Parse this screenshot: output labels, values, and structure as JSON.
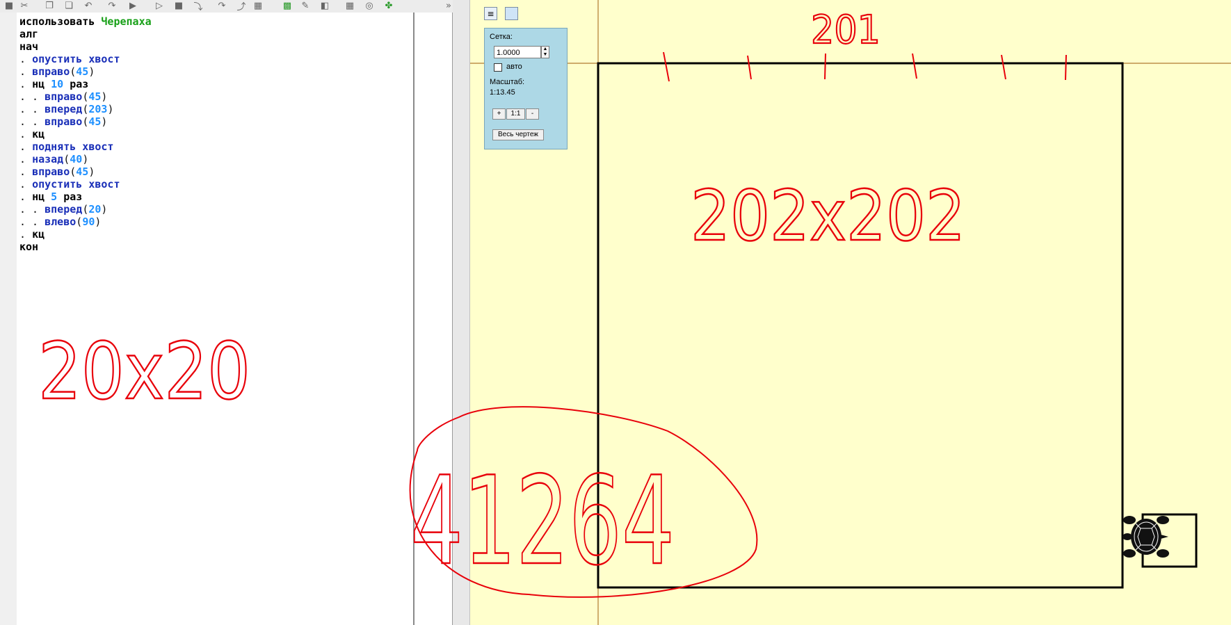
{
  "toolbar": {
    "icons": [
      "save-icon",
      "cut-icon",
      "copy-icon",
      "paste-icon",
      "undo-icon",
      "redo-icon",
      "run-icon",
      "step-icon",
      "stop-icon",
      "step-into-icon",
      "step-over-icon",
      "step-out-icon",
      "robot-icon",
      "grid-icon",
      "pen-icon",
      "turtle-window-icon",
      "table-icon",
      "gamepad-icon",
      "turtle-icon"
    ],
    "more": "»"
  },
  "code": {
    "lines": [
      [
        {
          "t": "использовать ",
          "c": "kw"
        },
        {
          "t": "Черепаха",
          "c": "mod"
        }
      ],
      [
        {
          "t": "алг",
          "c": "kw"
        }
      ],
      [
        {
          "t": "нач",
          "c": "kw"
        }
      ],
      [
        {
          "t": ". ",
          "c": "pun"
        },
        {
          "t": "опустить хвост",
          "c": "cmd"
        }
      ],
      [
        {
          "t": ". ",
          "c": "pun"
        },
        {
          "t": "вправо",
          "c": "cmd"
        },
        {
          "t": "(",
          "c": "pun"
        },
        {
          "t": "45",
          "c": "num"
        },
        {
          "t": ")",
          "c": "pun"
        }
      ],
      [
        {
          "t": ". ",
          "c": "pun"
        },
        {
          "t": "нц ",
          "c": "kw"
        },
        {
          "t": "10",
          "c": "num"
        },
        {
          "t": " раз",
          "c": "kw"
        }
      ],
      [
        {
          "t": ". . ",
          "c": "pun"
        },
        {
          "t": "вправо",
          "c": "cmd"
        },
        {
          "t": "(",
          "c": "pun"
        },
        {
          "t": "45",
          "c": "num"
        },
        {
          "t": ")",
          "c": "pun"
        }
      ],
      [
        {
          "t": ". . ",
          "c": "pun"
        },
        {
          "t": "вперед",
          "c": "cmd"
        },
        {
          "t": "(",
          "c": "pun"
        },
        {
          "t": "203",
          "c": "num"
        },
        {
          "t": ")",
          "c": "pun"
        }
      ],
      [
        {
          "t": ". . ",
          "c": "pun"
        },
        {
          "t": "вправо",
          "c": "cmd"
        },
        {
          "t": "(",
          "c": "pun"
        },
        {
          "t": "45",
          "c": "num"
        },
        {
          "t": ")",
          "c": "pun"
        }
      ],
      [
        {
          "t": ". ",
          "c": "pun"
        },
        {
          "t": "кц",
          "c": "kw"
        }
      ],
      [
        {
          "t": ". ",
          "c": "pun"
        },
        {
          "t": "поднять хвост",
          "c": "cmd"
        }
      ],
      [
        {
          "t": ". ",
          "c": "pun"
        },
        {
          "t": "назад",
          "c": "cmd"
        },
        {
          "t": "(",
          "c": "pun"
        },
        {
          "t": "40",
          "c": "num"
        },
        {
          "t": ")",
          "c": "pun"
        }
      ],
      [
        {
          "t": ". ",
          "c": "pun"
        },
        {
          "t": "вправо",
          "c": "cmd"
        },
        {
          "t": "(",
          "c": "pun"
        },
        {
          "t": "45",
          "c": "num"
        },
        {
          "t": ")",
          "c": "pun"
        }
      ],
      [
        {
          "t": ". ",
          "c": "pun"
        },
        {
          "t": "опустить хвост",
          "c": "cmd"
        }
      ],
      [
        {
          "t": ". ",
          "c": "pun"
        },
        {
          "t": "нц ",
          "c": "kw"
        },
        {
          "t": "5",
          "c": "num"
        },
        {
          "t": " раз",
          "c": "kw"
        }
      ],
      [
        {
          "t": ". . ",
          "c": "pun"
        },
        {
          "t": "вперед",
          "c": "cmd"
        },
        {
          "t": "(",
          "c": "pun"
        },
        {
          "t": "20",
          "c": "num"
        },
        {
          "t": ")",
          "c": "pun"
        }
      ],
      [
        {
          "t": ". . ",
          "c": "pun"
        },
        {
          "t": "влево",
          "c": "cmd"
        },
        {
          "t": "(",
          "c": "pun"
        },
        {
          "t": "90",
          "c": "num"
        },
        {
          "t": ")",
          "c": "pun"
        }
      ],
      [
        {
          "t": ". ",
          "c": "pun"
        },
        {
          "t": "кц",
          "c": "kw"
        }
      ],
      [
        {
          "t": "кон",
          "c": "kw"
        }
      ]
    ]
  },
  "panel": {
    "grid_label": "Сетка:",
    "grid_value": "1.0000",
    "auto_label": "авто",
    "auto_checked": false,
    "scale_label": "Масштаб:",
    "scale_value": "1:13.45",
    "zoom_in": "+",
    "zoom_reset": "1:1",
    "zoom_out": "-",
    "fit_all": "Весь чертеж"
  },
  "annotations": {
    "note_small_square": "20x20",
    "note_big_square": "202x202",
    "note_top": "201",
    "note_circled": "41264"
  },
  "colors": {
    "canvas_bg": "#ffffcc",
    "panel_bg": "#add8e6",
    "annotation": "#e8000a",
    "command": "#1a2fb8",
    "number": "#1e90ff",
    "module": "#18a018"
  }
}
